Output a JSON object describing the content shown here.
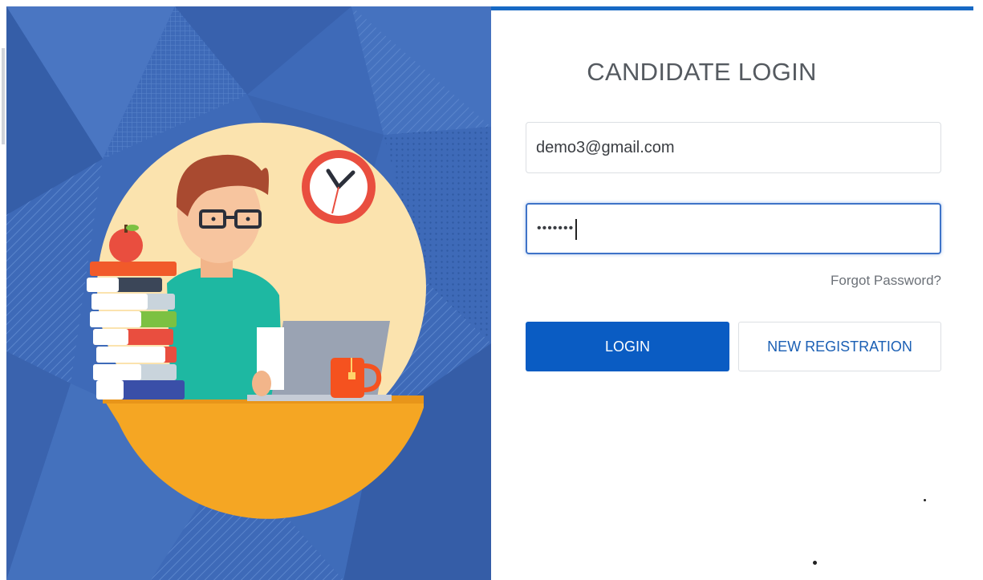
{
  "login": {
    "title": "CANDIDATE LOGIN",
    "email_value": "demo3@gmail.com",
    "password_value": "•••••••",
    "forgot_label": "Forgot Password?",
    "login_label": "LOGIN",
    "register_label": "NEW REGISTRATION"
  },
  "colors": {
    "brand_blue": "#0a5cc3",
    "hero_background": "#3e6ab8",
    "circle_fill": "#fbe3ae"
  },
  "icons": [
    "clock-icon",
    "apple-icon",
    "mug-icon",
    "laptop-icon"
  ]
}
